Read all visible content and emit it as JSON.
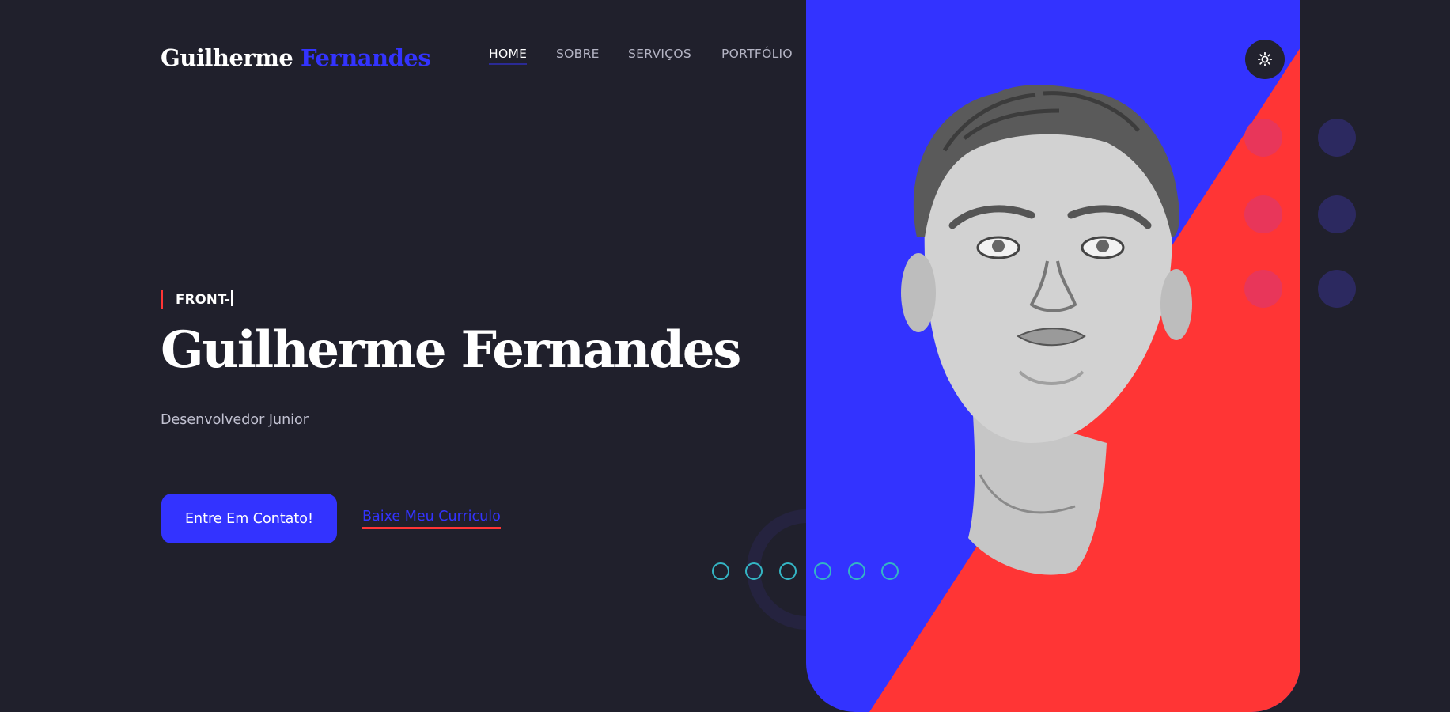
{
  "header": {
    "logo_first": "Guilherme",
    "logo_second": "Fernandes",
    "nav": [
      {
        "label": "HOME",
        "active": true
      },
      {
        "label": "SOBRE",
        "active": false
      },
      {
        "label": "SERVIÇOS",
        "active": false
      },
      {
        "label": "PORTFÓLIO",
        "active": false
      }
    ],
    "theme_toggle_icon": "sun-icon"
  },
  "hero": {
    "role_text": "FRONT-",
    "name": "Guilherme Fernandes",
    "subtitle": "Desenvolvedor Junior",
    "primary_button": "Entre Em Contato!",
    "secondary_link": "Baixe Meu Curriculo",
    "portrait": "portrait-illustration",
    "slider_indicator_count": 6
  },
  "colors": {
    "background": "#20202c",
    "accent_blue": "#3333ff",
    "accent_red": "#ff3535",
    "indicator_teal": "#34b5c4",
    "dot_red": "#e8365a",
    "dot_purple": "#2c2960"
  }
}
